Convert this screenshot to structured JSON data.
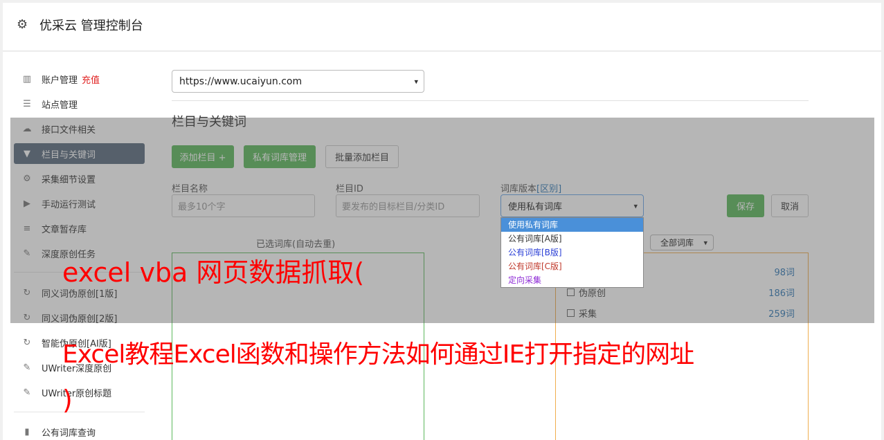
{
  "header": {
    "title": "优采云 管理控制台",
    "icon": "gear-icon"
  },
  "sidebar": {
    "items": [
      {
        "label": "账户管理",
        "extra": "充值",
        "icon": "bar-chart-icon"
      },
      {
        "label": "站点管理",
        "icon": "server-icon"
      },
      {
        "label": "接口文件相关",
        "icon": "cloud-upload-icon"
      },
      {
        "label": "栏目与关键词",
        "icon": "filter-icon",
        "active": true
      },
      {
        "label": "采集细节设置",
        "icon": "cogs-icon"
      },
      {
        "label": "手动运行测试",
        "icon": "play-circle-icon"
      },
      {
        "label": "文章暂存库",
        "icon": "database-icon"
      },
      {
        "label": "深度原创任务",
        "icon": "edit-icon"
      },
      {
        "label": "同义词伪原创[1版]",
        "icon": "refresh-icon"
      },
      {
        "label": "同义词伪原创[2版]",
        "icon": "refresh-icon"
      },
      {
        "label": "智能伪原创[AI版]",
        "icon": "refresh-icon"
      },
      {
        "label": "UWriter深度原创",
        "icon": "edit-icon"
      },
      {
        "label": "UWriter原创标题",
        "icon": "edit-icon"
      },
      {
        "label": "公有词库查询",
        "icon": "book-icon"
      }
    ]
  },
  "main": {
    "site_select": "https://www.ucaiyun.com",
    "section_title": "栏目与关键词",
    "buttons": {
      "add_column": "添加栏目 +",
      "private_lib": "私有词库管理",
      "batch_add": "批量添加栏目",
      "save": "保存",
      "cancel": "取消"
    },
    "form": {
      "name_label": "栏目名称",
      "name_placeholder": "最多10个字",
      "id_label": "栏目ID",
      "id_placeholder": "要发布的目标栏目/分类ID",
      "version_label": "词库版本",
      "version_link": "[区别]",
      "version_value": "使用私有词库"
    },
    "selected_panel_title": "已选词库(自动去重)",
    "library_filter": "全部词库",
    "libraries": [
      {
        "label": "",
        "count": "98词"
      },
      {
        "label": "伪原创",
        "count": "186词"
      },
      {
        "label": "采集",
        "count": "259词"
      }
    ],
    "dropdown": {
      "options": [
        {
          "label": "使用私有词库",
          "color": "#ffffff",
          "selected": true
        },
        {
          "label": "公有词库[A版]",
          "color": "#333333"
        },
        {
          "label": "公有词库[B版]",
          "color": "#2b3fd6"
        },
        {
          "label": "公有词库[C版]",
          "color": "#c0392b"
        },
        {
          "label": "定向采集",
          "color": "#8e2bd6"
        }
      ]
    }
  },
  "caption": {
    "line1": "excel vba 网页数据抓取(",
    "line2": "Excel教程Excel函数和操作方法如何通过IE打开指定的网址",
    "line3": ")"
  }
}
